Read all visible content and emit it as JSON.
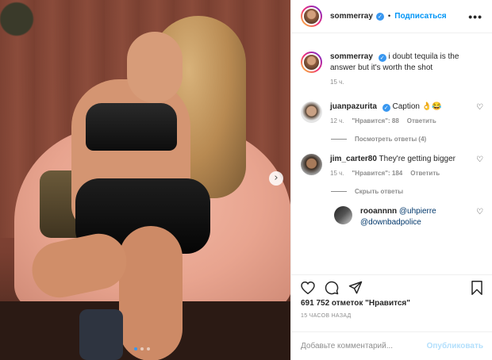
{
  "post": {
    "image_alt_icon": "photo",
    "carousel": {
      "total": 3,
      "active": 1
    }
  },
  "header": {
    "username": "sommerray",
    "separator": "•",
    "follow_label": "Подписаться",
    "more_label": "•••"
  },
  "caption": {
    "username": "sommerray",
    "text": "i doubt tequila is the answer but it's worth the shot",
    "time": "15 ч."
  },
  "comments": [
    {
      "username": "juanpazurita",
      "text": "Caption 👌😂",
      "time": "12 ч.",
      "likes": "\"Нравится\": 88",
      "reply": "Ответить",
      "replies_toggle": "Посмотреть ответы (4)"
    },
    {
      "username": "jim_carter80",
      "text": "They're getting bigger",
      "time": "15 ч.",
      "likes": "\"Нравится\": 184",
      "reply": "Ответить",
      "replies_toggle": "Скрыть ответы"
    }
  ],
  "reply": {
    "username": "rooannnn",
    "mention1": "@uhpierre",
    "mention2": "@downbadpolice"
  },
  "stats": {
    "likes": "691 752 отметок \"Нравится\"",
    "posted": "15 ЧАСОВ НАЗАД"
  },
  "composer": {
    "placeholder": "Добавьте комментарий...",
    "publish_label": "Опубликовать"
  },
  "colors": {
    "accent": "#0095f6",
    "verified": "#3897f0",
    "muted": "#8e8e8e",
    "publish_disabled": "#b2dffc"
  }
}
